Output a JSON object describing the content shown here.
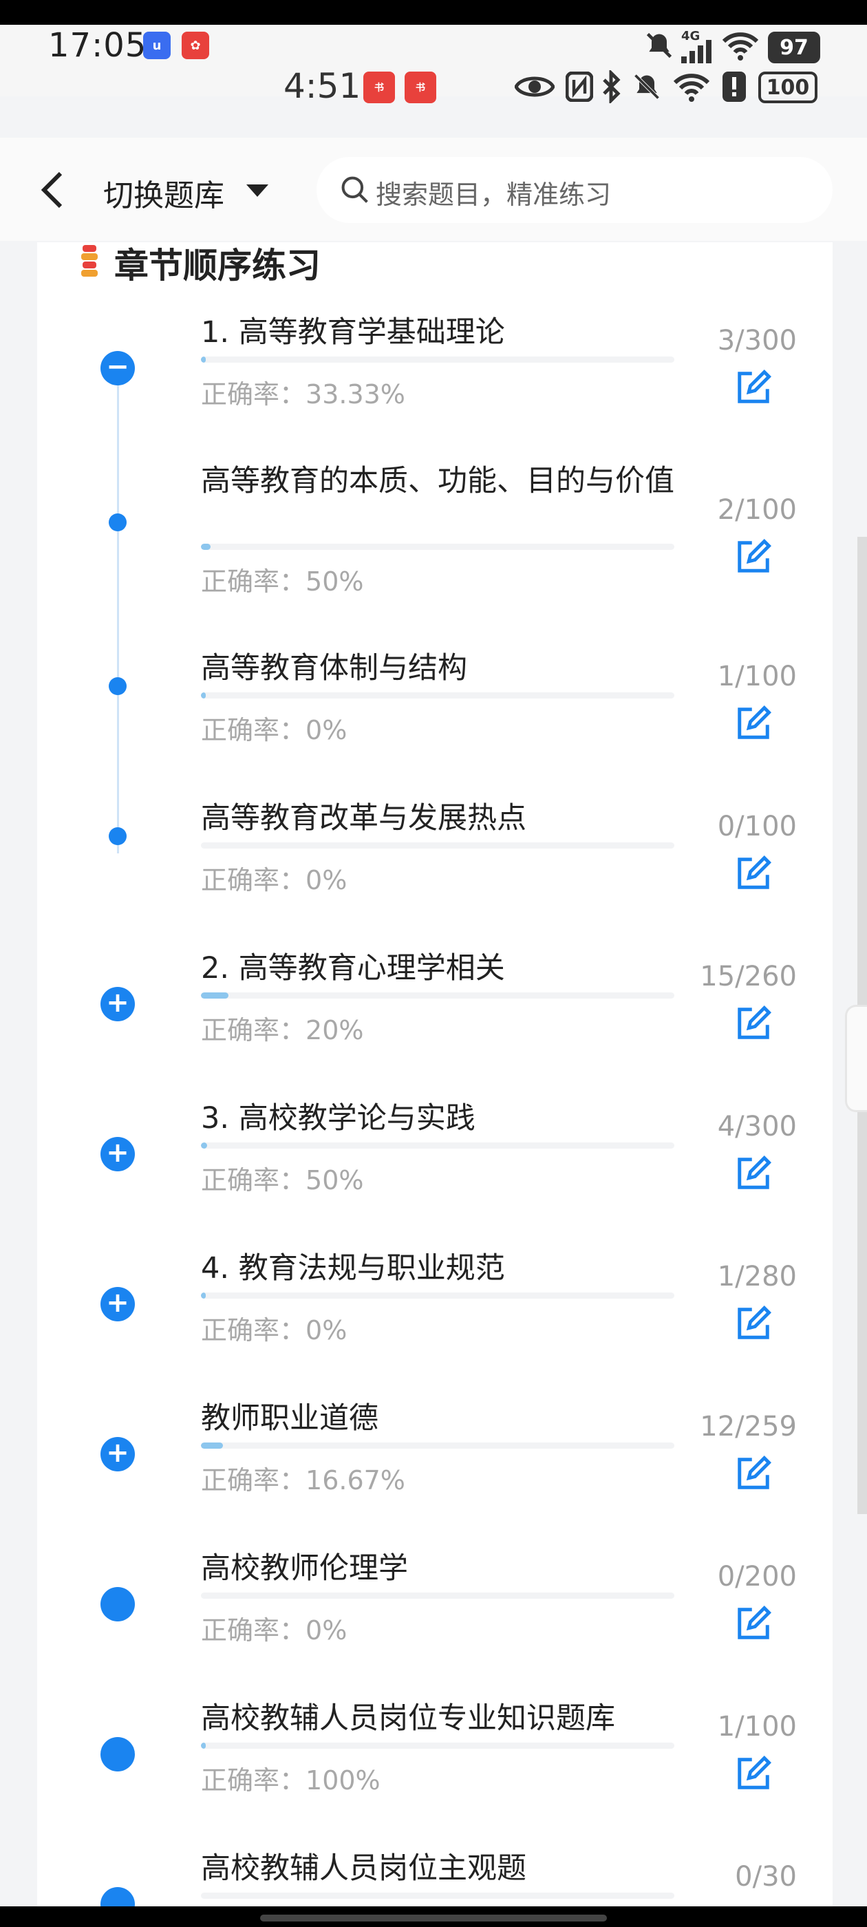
{
  "status_outer": {
    "time": "17:05",
    "battery": "97",
    "network": "4G"
  },
  "status_inner": {
    "time": "4:51",
    "battery": "100"
  },
  "header": {
    "switch_label": "切换题库",
    "search_placeholder": "搜索题目，精准练习"
  },
  "section": {
    "title": "章节顺序练习"
  },
  "accuracy_prefix": "正确率：",
  "chapters": [
    {
      "title": "1. 高等教育学基础理论",
      "count": "3/300",
      "accuracy": "33.33%",
      "progress": 0.01,
      "node": "minus"
    },
    {
      "title": "高等教育的本质、功能、目的与价值",
      "count": "2/100",
      "accuracy": "50%",
      "progress": 0.02,
      "node": "dot"
    },
    {
      "title": "高等教育体制与结构",
      "count": "1/100",
      "accuracy": "0%",
      "progress": 0.01,
      "node": "dot"
    },
    {
      "title": "高等教育改革与发展热点",
      "count": "0/100",
      "accuracy": "0%",
      "progress": 0.0,
      "node": "dot"
    },
    {
      "title": "2. 高等教育心理学相关",
      "count": "15/260",
      "accuracy": "20%",
      "progress": 0.058,
      "node": "plus"
    },
    {
      "title": "3. 高校教学论与实践",
      "count": "4/300",
      "accuracy": "50%",
      "progress": 0.013,
      "node": "plus"
    },
    {
      "title": "4. 教育法规与职业规范",
      "count": "1/280",
      "accuracy": "0%",
      "progress": 0.004,
      "node": "plus"
    },
    {
      "title": "教师职业道德",
      "count": "12/259",
      "accuracy": "16.67%",
      "progress": 0.046,
      "node": "plus"
    },
    {
      "title": "高校教师伦理学",
      "count": "0/200",
      "accuracy": "0%",
      "progress": 0.0,
      "node": "plain"
    },
    {
      "title": "高校教辅人员岗位专业知识题库",
      "count": "1/100",
      "accuracy": "100%",
      "progress": 0.01,
      "node": "plain"
    },
    {
      "title": "高校教辅人员岗位主观题",
      "count": "0/30",
      "accuracy": "",
      "progress": 0.0,
      "node": "plain"
    }
  ]
}
